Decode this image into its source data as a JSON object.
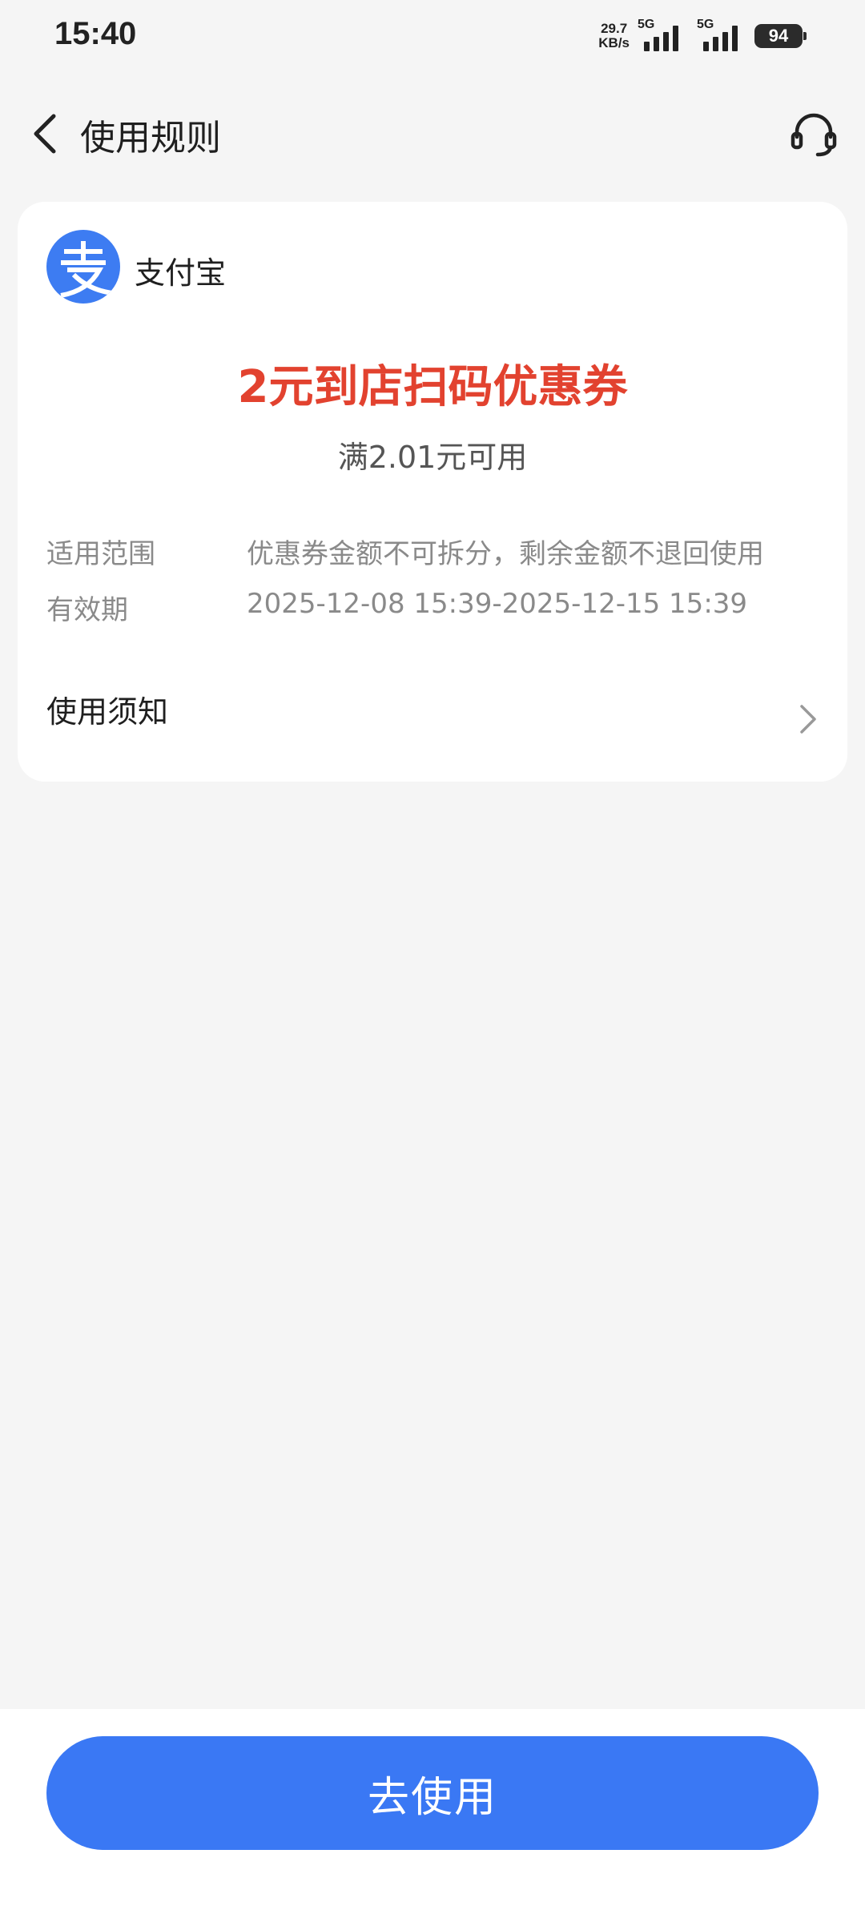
{
  "status_bar": {
    "time": "15:40",
    "net_speed_value": "29.7",
    "net_speed_unit": "KB/s",
    "signal1_label": "5G",
    "signal2_label": "5G",
    "battery": "94"
  },
  "header": {
    "title": "使用规则",
    "back_icon": "chevron-left-icon",
    "support_icon": "headset-icon"
  },
  "card": {
    "brand_name": "支付宝",
    "brand_logo_glyph": "支",
    "coupon_title": "2元到店扫码优惠券",
    "coupon_condition": "满2.01元可用",
    "scope_label": "适用范围",
    "scope_value": "优惠券金额不可拆分，剩余金额不退回使用",
    "validity_label": "有效期",
    "validity_value": "2025-12-08 15:39-2025-12-15 15:39",
    "notice_label": "使用须知"
  },
  "bottom": {
    "use_button_label": "去使用"
  },
  "colors": {
    "accent_blue": "#3a78f4",
    "coupon_red": "#e2422f",
    "background": "#f5f5f5"
  }
}
